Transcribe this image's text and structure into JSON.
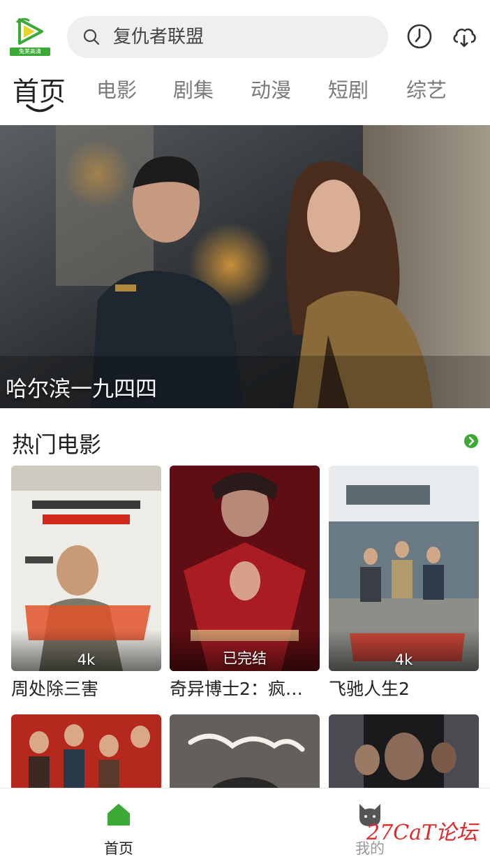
{
  "header": {
    "logo_text": "兔莱高清",
    "search_placeholder": "复仇者联盟"
  },
  "tabs": [
    "首页",
    "电影",
    "剧集",
    "动漫",
    "短剧",
    "综艺"
  ],
  "banner": {
    "title": "哈尔滨一九四四"
  },
  "section": {
    "title": "热门电影"
  },
  "movies": [
    {
      "title": "周处除三害",
      "badge": "4k"
    },
    {
      "title": "奇异博士2：疯…",
      "badge": "已完结"
    },
    {
      "title": "飞驰人生2",
      "badge": "4k"
    }
  ],
  "bottom_nav": [
    {
      "label": "首页"
    },
    {
      "label": "我的"
    }
  ],
  "watermark": "27CaT论坛",
  "colors": {
    "accent": "#3aa935",
    "tab_inactive": "#7a7a7a",
    "watermark": "#e02a2a"
  }
}
